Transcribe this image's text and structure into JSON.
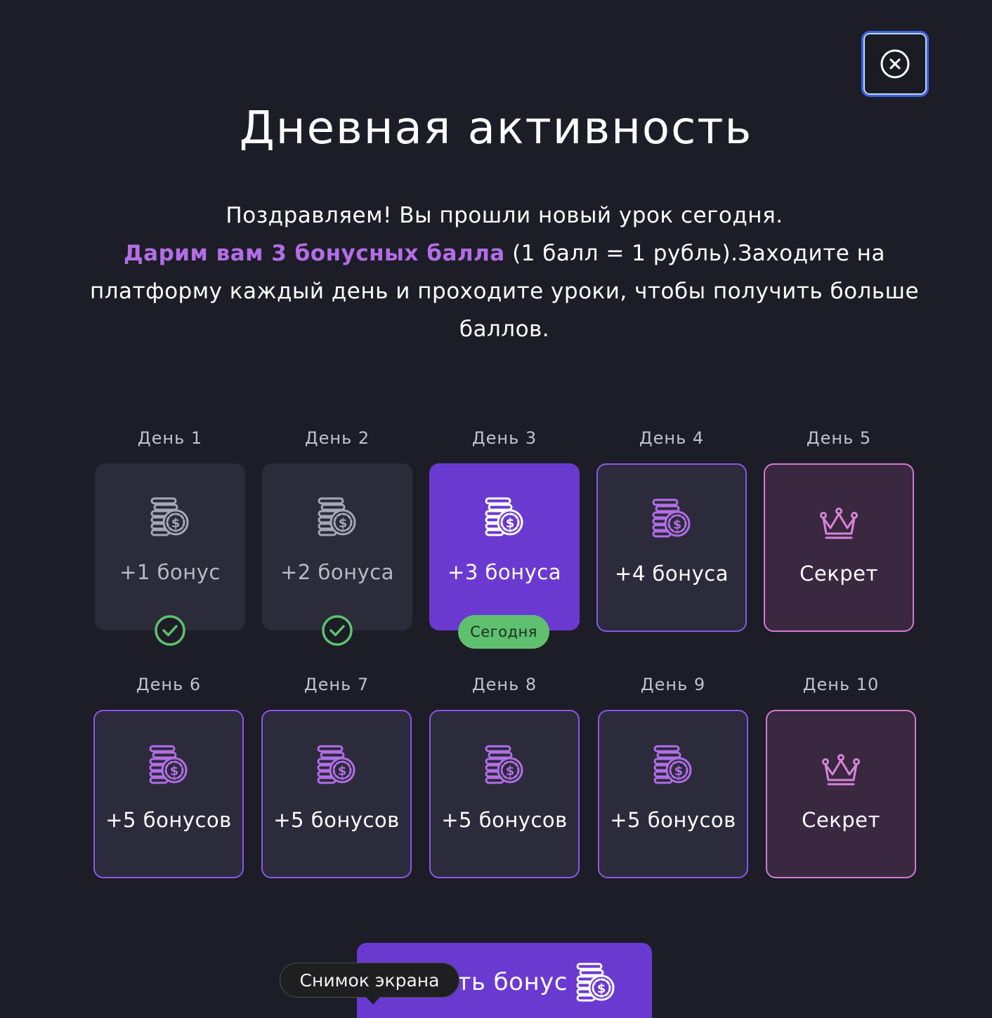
{
  "header": {
    "close_icon": "close-circle-icon",
    "title": "Дневная активность"
  },
  "message": {
    "line1": "Поздравляем! Вы прошли новый урок сегодня.",
    "highlight": "Дарим вам 3 бонусных балла",
    "rest": " (1 балл = 1 рубль).Заходите на платформу каждый день и проходите уроки, чтобы получить больше баллов."
  },
  "days": [
    {
      "label": "День 1",
      "reward": "+1 бонус",
      "state": "done",
      "icon": "coins-icon"
    },
    {
      "label": "День 2",
      "reward": "+2 бонуса",
      "state": "done",
      "icon": "coins-icon"
    },
    {
      "label": "День 3",
      "reward": "+3 бонуса",
      "state": "today",
      "icon": "coins-icon"
    },
    {
      "label": "День 4",
      "reward": "+4 бонуса",
      "state": "future",
      "icon": "coins-icon"
    },
    {
      "label": "День 5",
      "reward": "Секрет",
      "state": "secret",
      "icon": "crown-icon"
    },
    {
      "label": "День 6",
      "reward": "+5 бонусов",
      "state": "future",
      "icon": "coins-icon"
    },
    {
      "label": "День 7",
      "reward": "+5 бонусов",
      "state": "future",
      "icon": "coins-icon"
    },
    {
      "label": "День 8",
      "reward": "+5 бонусов",
      "state": "future",
      "icon": "coins-icon"
    },
    {
      "label": "День 9",
      "reward": "+5 бонусов",
      "state": "future",
      "icon": "coins-icon"
    },
    {
      "label": "День 10",
      "reward": "Секрет",
      "state": "secret",
      "icon": "crown-icon"
    }
  ],
  "today_badge": "Сегодня",
  "get_bonus_button": {
    "label": "ть бонус",
    "icon": "coins-icon"
  },
  "tooltip": "Снимок экрана",
  "colors": {
    "background": "#1d1d27",
    "accent": "#6a3ad0",
    "highlight": "#b36ee6",
    "success": "#5fc06f",
    "secret_border": "#d27ad2"
  }
}
